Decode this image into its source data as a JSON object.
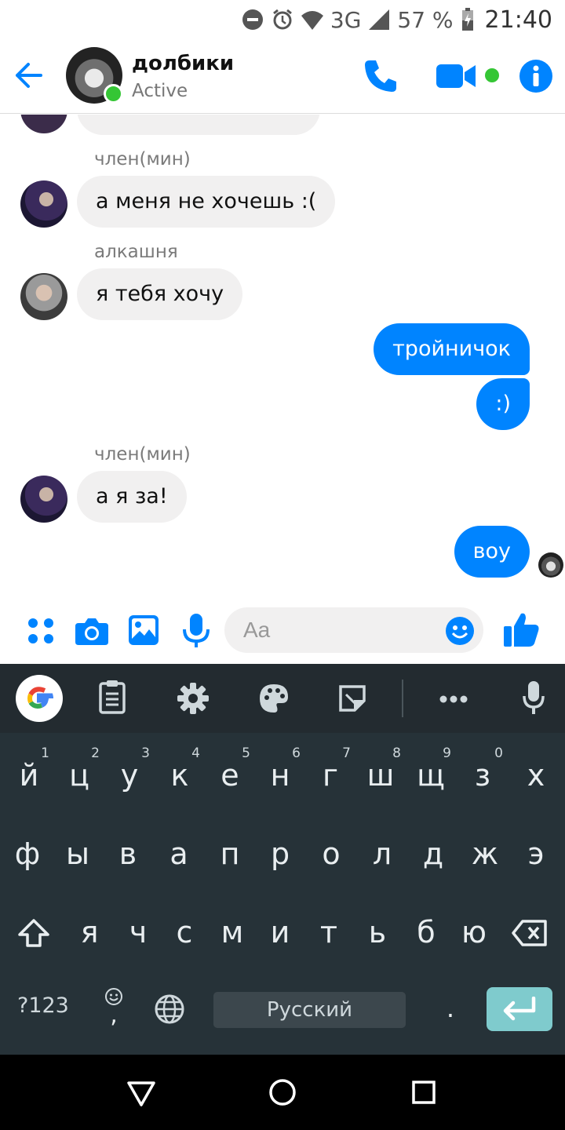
{
  "status_bar": {
    "network": "3G",
    "battery": "57 %",
    "time": "21:40",
    "icons": [
      "do-not-disturb-icon",
      "alarm-icon",
      "wifi-icon",
      "signal-icon",
      "battery-charging-icon"
    ]
  },
  "header": {
    "title": "долбики",
    "status": "Active",
    "actions": [
      "back-arrow-icon",
      "phone-icon",
      "video-camera-icon",
      "info-icon"
    ]
  },
  "messages": [
    {
      "sender": "член(мин)",
      "text": "а меня не хочешь :(",
      "direction": "in"
    },
    {
      "sender": "алкашня",
      "text": "я тебя хочу",
      "direction": "in"
    },
    {
      "text": "тройничок",
      "direction": "out"
    },
    {
      "text": ":)",
      "direction": "out"
    },
    {
      "sender": "член(мин)",
      "text": "а я за!",
      "direction": "in"
    },
    {
      "text": "воу",
      "direction": "out"
    }
  ],
  "composer": {
    "placeholder": "Aa",
    "icons": [
      "more-apps-icon",
      "camera-icon",
      "gallery-icon",
      "microphone-icon",
      "emoji-icon",
      "thumbs-up-icon"
    ]
  },
  "keyboard": {
    "toolbar": [
      "google-icon",
      "clipboard-icon",
      "settings-gear-icon",
      "theme-palette-icon",
      "sticker-icon",
      "more-dots-icon",
      "voice-mic-icon"
    ],
    "rows": [
      [
        "й",
        "ц",
        "у",
        "к",
        "е",
        "н",
        "г",
        "ш",
        "щ",
        "з",
        "х"
      ],
      [
        "ф",
        "ы",
        "в",
        "а",
        "п",
        "р",
        "о",
        "л",
        "д",
        "ж",
        "э"
      ],
      [
        "я",
        "ч",
        "с",
        "м",
        "и",
        "т",
        "ь",
        "б",
        "ю"
      ]
    ],
    "digit_hints": [
      "1",
      "2",
      "3",
      "4",
      "5",
      "6",
      "7",
      "8",
      "9",
      "0"
    ],
    "symbols_key": "?123",
    "comma_key": ",",
    "space_label": "Русский",
    "period_key": "."
  },
  "nav_bar": [
    "back-triangle-icon",
    "home-circle-icon",
    "recents-square-icon"
  ]
}
